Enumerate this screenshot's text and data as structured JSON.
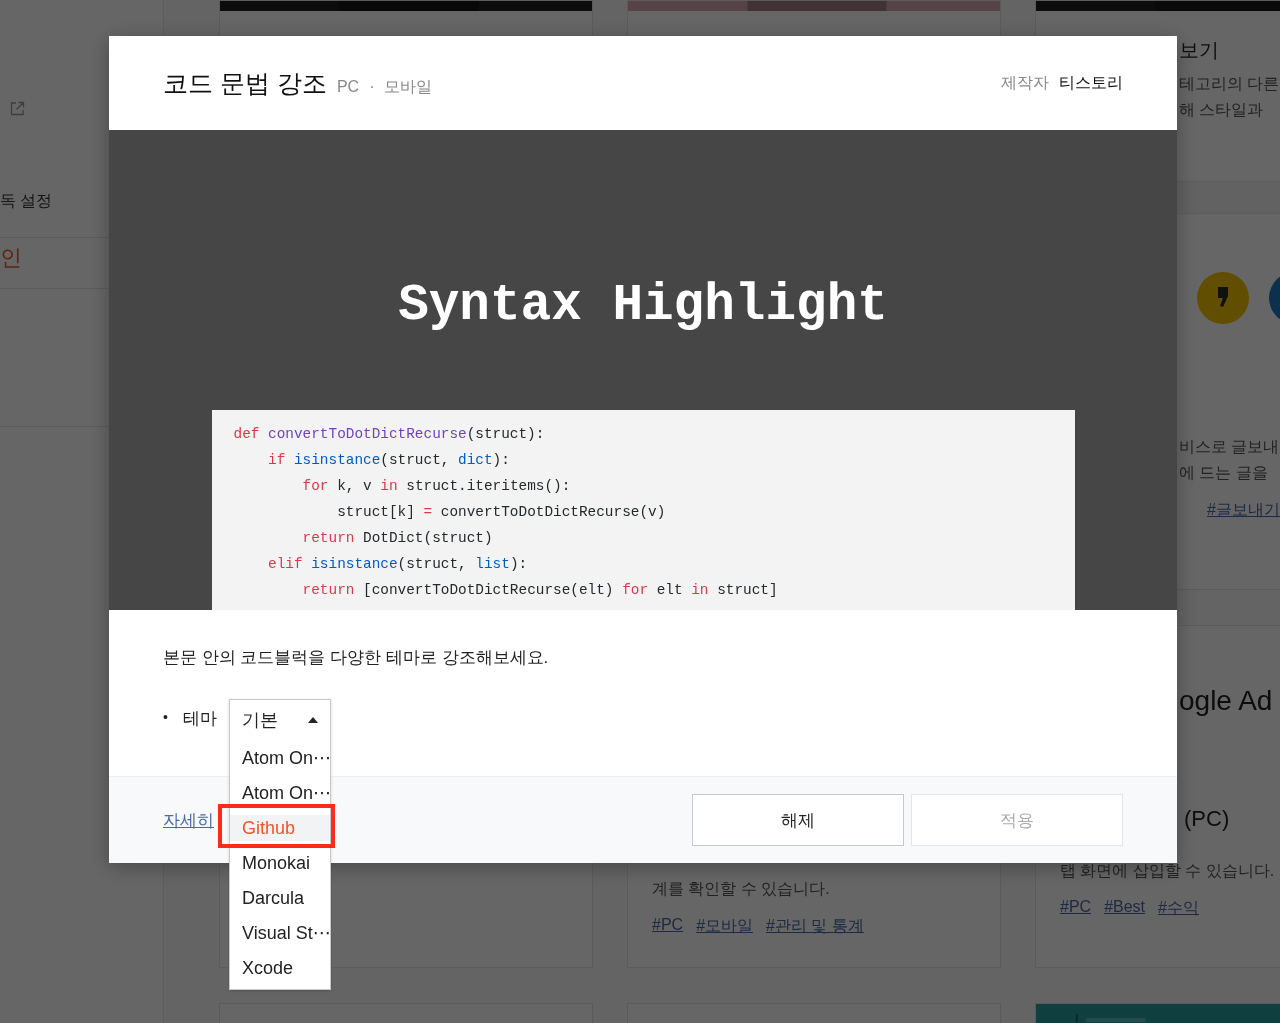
{
  "background": {
    "sidebar": {
      "items": [
        {
          "kind": "plain",
          "label": "독 설정"
        },
        {
          "kind": "accent",
          "label": "인"
        }
      ]
    },
    "right_top_card": {
      "heading": "보기",
      "lines": [
        "테고리의 다른",
        "해 스타일과"
      ],
      "body_lines": [
        "비스로 글보내",
        "에 드는 글을"
      ],
      "tags": [
        "#글보내기"
      ]
    },
    "middle_card": {
      "lines": [
        "계를 확인할 수 있습니다."
      ],
      "tags": [
        "#PC",
        "#모바일",
        "#관리 및 통계"
      ]
    },
    "right_card": {
      "heading": "ogle Ad",
      "subheading": "(PC)",
      "lines": [
        "탭 화면에 삽입할 수 있습니다."
      ],
      "tags": [
        "#PC",
        "#Best",
        "#수익"
      ]
    }
  },
  "modal": {
    "title": "코드 문법 강조",
    "platforms": [
      "PC",
      "모바일"
    ],
    "separator": "·",
    "author_label": "제작자",
    "author": "티스토리",
    "preview": {
      "title": "Syntax Highlight",
      "code_lines": [
        [
          {
            "kind": "keyword",
            "text": "def "
          },
          {
            "kind": "function",
            "text": "convertToDotDictRecurse"
          },
          {
            "kind": "plain",
            "text": "(struct):"
          }
        ],
        [
          {
            "kind": "keyword",
            "text": "    if "
          },
          {
            "kind": "builtin",
            "text": "isinstance"
          },
          {
            "kind": "plain",
            "text": "(struct, "
          },
          {
            "kind": "builtin",
            "text": "dict"
          },
          {
            "kind": "plain",
            "text": "):"
          }
        ],
        [
          {
            "kind": "keyword",
            "text": "        for "
          },
          {
            "kind": "plain",
            "text": "k, v "
          },
          {
            "kind": "keyword",
            "text": "in "
          },
          {
            "kind": "plain",
            "text": "struct.iteritems():"
          }
        ],
        [
          {
            "kind": "plain",
            "text": "            struct[k] "
          },
          {
            "kind": "keyword",
            "text": "= "
          },
          {
            "kind": "plain",
            "text": "convertToDotDictRecurse(v)"
          }
        ],
        [
          {
            "kind": "keyword",
            "text": "        return "
          },
          {
            "kind": "plain",
            "text": "DotDict(struct)"
          }
        ],
        [
          {
            "kind": "keyword",
            "text": "    elif "
          },
          {
            "kind": "builtin",
            "text": "isinstance"
          },
          {
            "kind": "plain",
            "text": "(struct, "
          },
          {
            "kind": "builtin",
            "text": "list"
          },
          {
            "kind": "plain",
            "text": "):"
          }
        ],
        [
          {
            "kind": "keyword",
            "text": "        return "
          },
          {
            "kind": "plain",
            "text": "[convertToDotDictRecurse(elt) "
          },
          {
            "kind": "keyword",
            "text": "for "
          },
          {
            "kind": "plain",
            "text": "elt "
          },
          {
            "kind": "keyword",
            "text": "in "
          },
          {
            "kind": "plain",
            "text": "struct]"
          }
        ]
      ]
    },
    "description": "본문 안의 코드블럭을 다양한 테마로 강조해보세요.",
    "settings": [
      {
        "bullet": "•",
        "label": "테마",
        "select": {
          "value": "기본",
          "expanded": true,
          "options": [
            {
              "label": "Atom On⋯",
              "highlighted": false
            },
            {
              "label": "Atom On⋯",
              "highlighted": false
            },
            {
              "label": "Github",
              "highlighted": true
            },
            {
              "label": "Monokai",
              "highlighted": false
            },
            {
              "label": "Darcula",
              "highlighted": false
            },
            {
              "label": "Visual St⋯",
              "highlighted": false
            },
            {
              "label": "Xcode",
              "highlighted": false
            }
          ]
        }
      }
    ],
    "more_link": "자세히",
    "buttons": [
      {
        "label": "해제",
        "disabled": false
      },
      {
        "label": "적용",
        "disabled": true
      }
    ]
  }
}
